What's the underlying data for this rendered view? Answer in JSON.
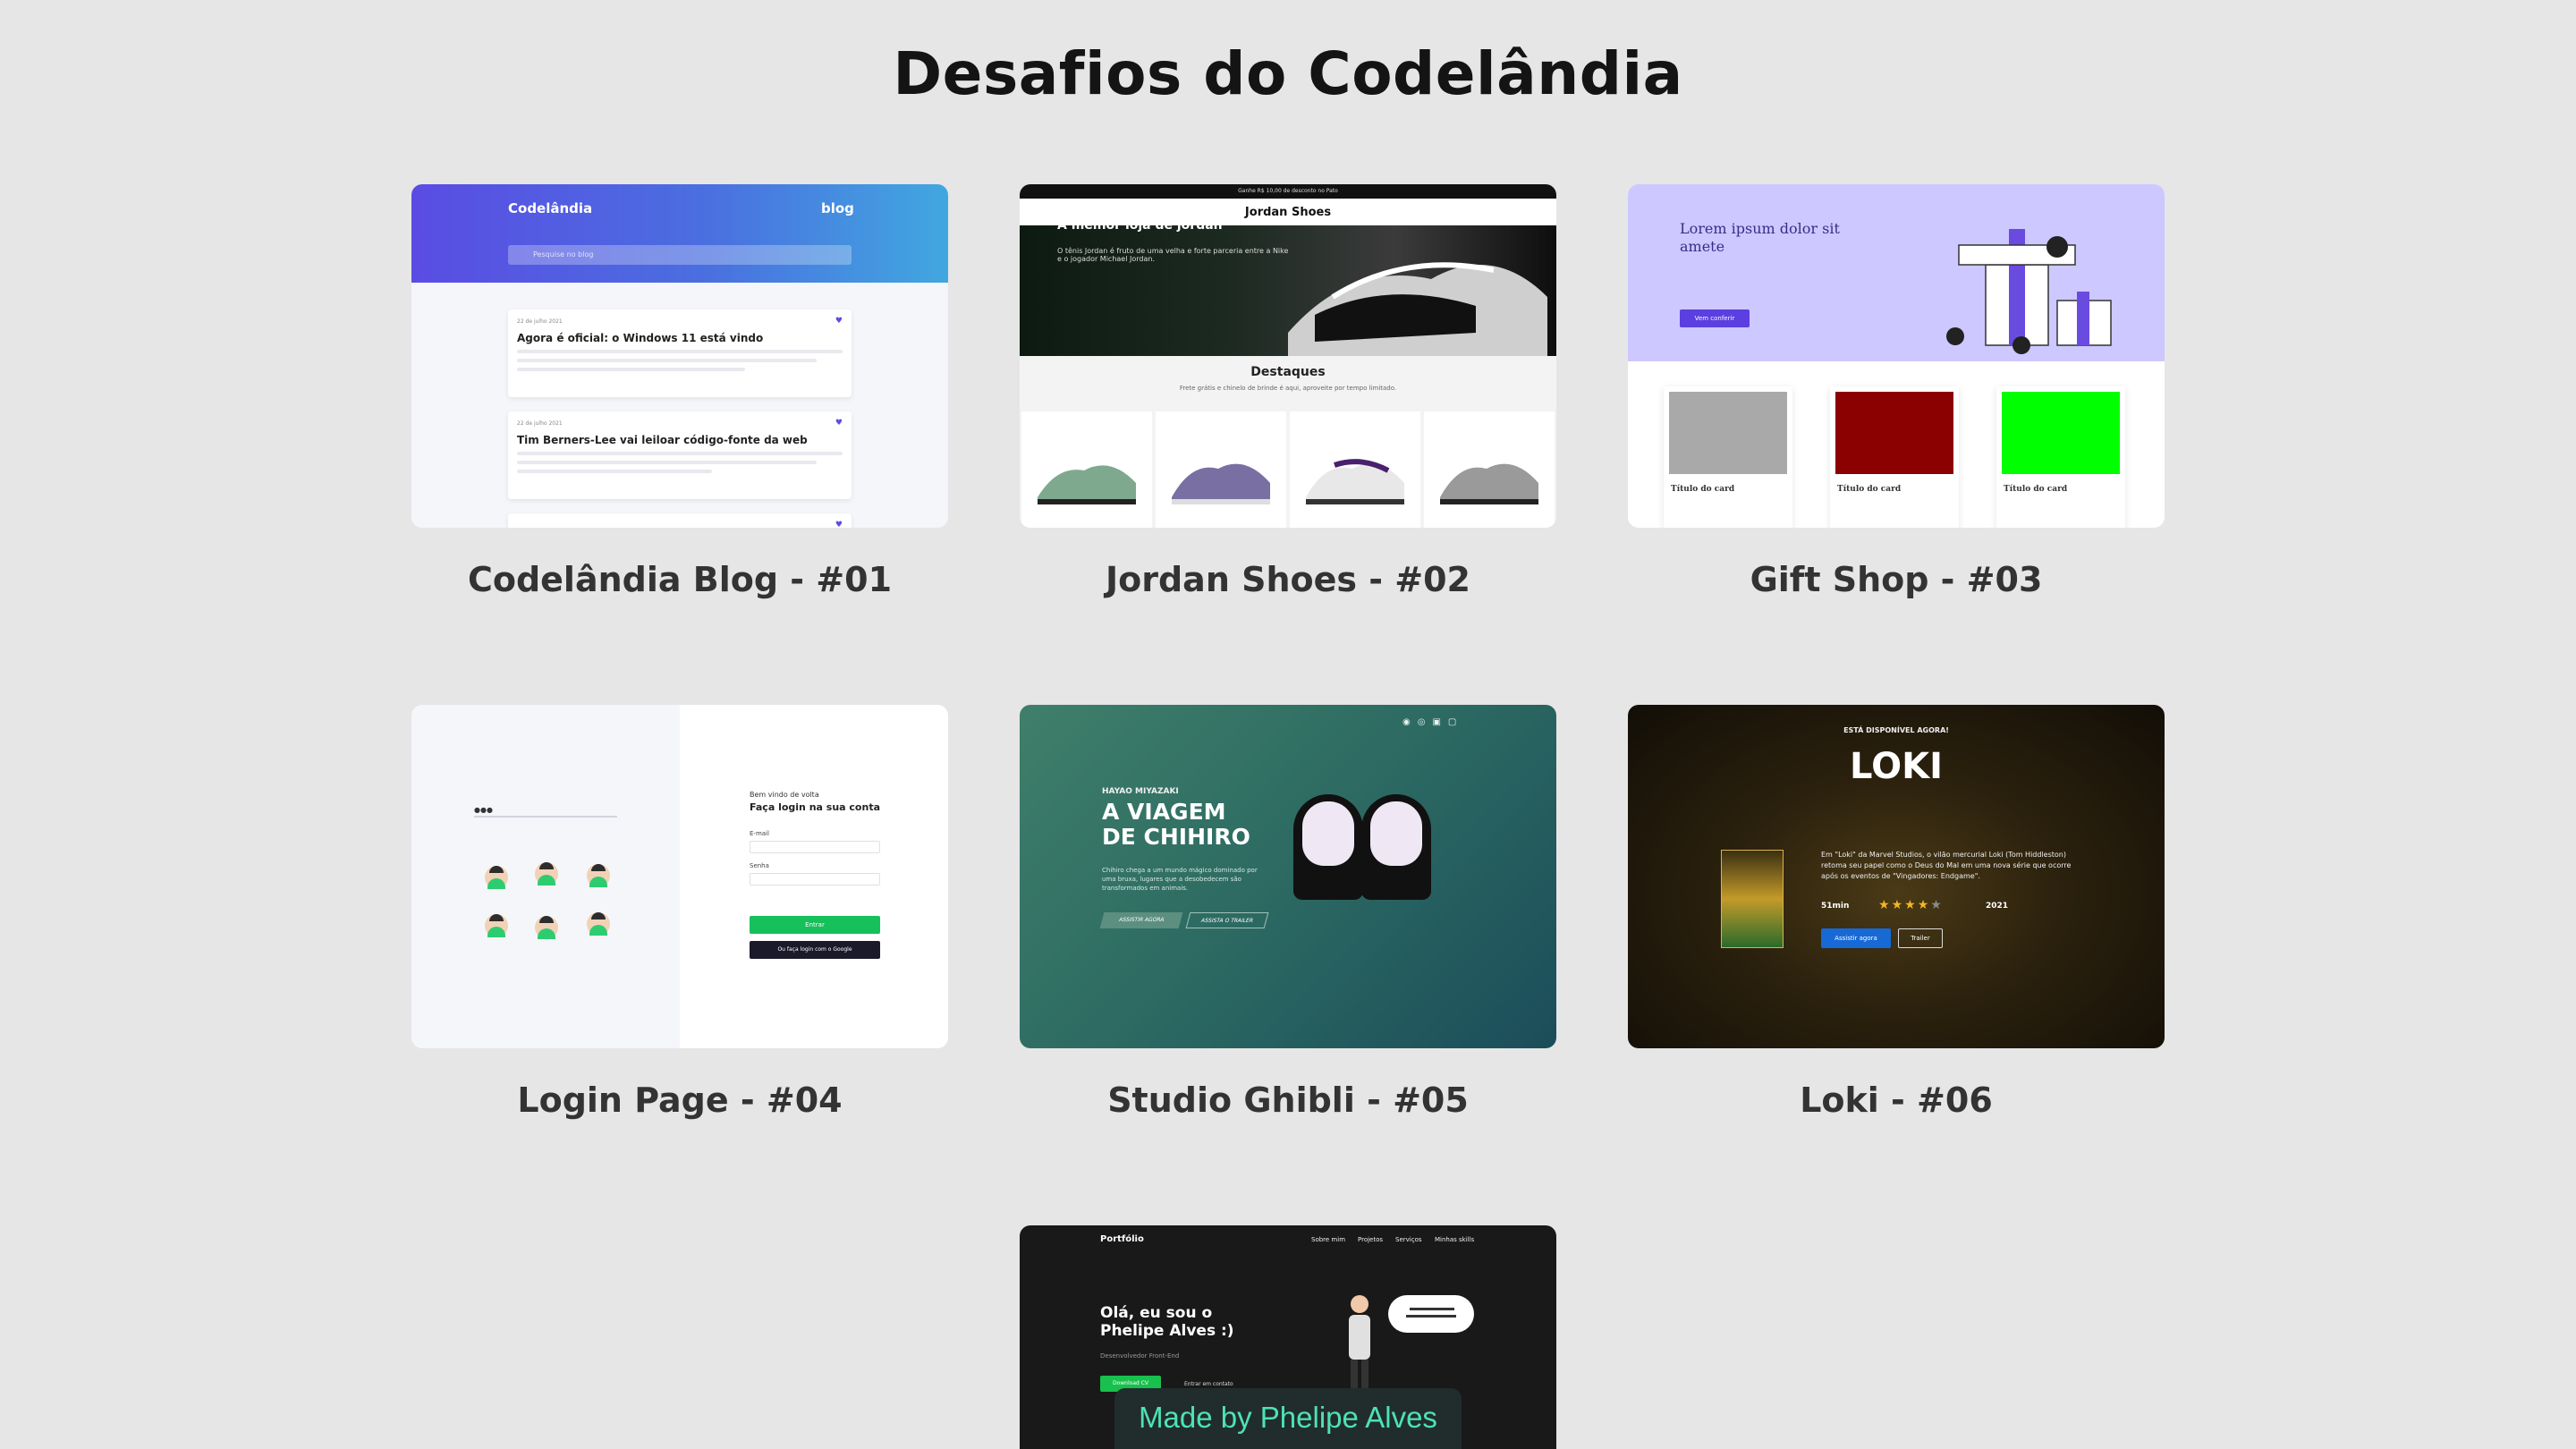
{
  "page": {
    "title": "Desafios do Codelândia"
  },
  "cards": [
    {
      "label": "Codelândia Blog - #01"
    },
    {
      "label": "Jordan Shoes - #02"
    },
    {
      "label": "Gift Shop - #03"
    },
    {
      "label": "Login Page - #04"
    },
    {
      "label": "Studio Ghibli - #05"
    },
    {
      "label": "Loki - #06"
    },
    {
      "label": "Portfolio - #07"
    }
  ],
  "blog": {
    "logo": "Codelândia",
    "nav": "blog",
    "search_placeholder": "Pesquise no blog",
    "posts": [
      {
        "date": "22 de julho 2021",
        "title": "Agora é oficial: o Windows 11 está vindo"
      },
      {
        "date": "22 de julho 2021",
        "title": "Tim Berners-Lee vai leiloar código-fonte da web"
      }
    ]
  },
  "jordan": {
    "topbar": "Ganhe R$ 10,00 de desconto no Pato",
    "brand": "Jordan Shoes",
    "hero_title": "A melhor loja de jordan",
    "hero_sub": "O tênis Jordan é fruto de uma velha e forte parceria entre a Nike e o jogador Michael Jordan.",
    "section": "Destaques",
    "section_sub": "Frete grátis e chinelo de brinde é aqui, aproveite por tempo limitado."
  },
  "gift": {
    "hero_title": "Lorem ipsum dolor sit amete",
    "button": "Vem conferir",
    "card_title": "Título do card",
    "swatches": [
      "#a9a9a9",
      "#8b0000",
      "#00ff00"
    ]
  },
  "login": {
    "hello": "Bem vindo de volta",
    "heading": "Faça login na sua conta",
    "email": "E-mail",
    "password": "Senha",
    "enter": "Entrar",
    "google": "Ou faça login com o Google"
  },
  "ghibli": {
    "kicker": "HAYAO MIYAZAKI",
    "title_line1": "A VIAGEM",
    "title_line2": "DE CHIHIRO",
    "text": "Chihiro chega a um mundo mágico dominado por uma bruxa, lugares que a desobedecem são transformados em animais.",
    "btn_primary": "ASSISTIR AGORA",
    "btn_secondary": "ASSISTA O TRAILER"
  },
  "loki": {
    "kicker": "ESTÁ DISPONÍVEL AGORA!",
    "title": "LOKI",
    "desc": "Em \"Loki\" da Marvel Studios, o vilão mercurial Loki (Tom Hiddleston) retoma seu papel como o Deus do Mal em uma nova série que ocorre após os eventos de \"Vingadores: Endgame\".",
    "minutes": "51min",
    "stars": "★★★★★",
    "rating": 4,
    "year": "2021",
    "watch": "Assistir agora",
    "trailer": "Trailer"
  },
  "portfolio": {
    "logo": "Portfólio",
    "nav": [
      "Sobre mim",
      "Projetos",
      "Serviços",
      "Minhas skills"
    ],
    "hello_line1": "Olá, eu sou o",
    "hello_line2": "Phelipe Alves :)",
    "role": "Desenvolvedor Front-End",
    "cv": "Download CV",
    "contact": "Entrar em contato"
  },
  "footer": {
    "made_by": "Made by Phelipe Alves"
  }
}
